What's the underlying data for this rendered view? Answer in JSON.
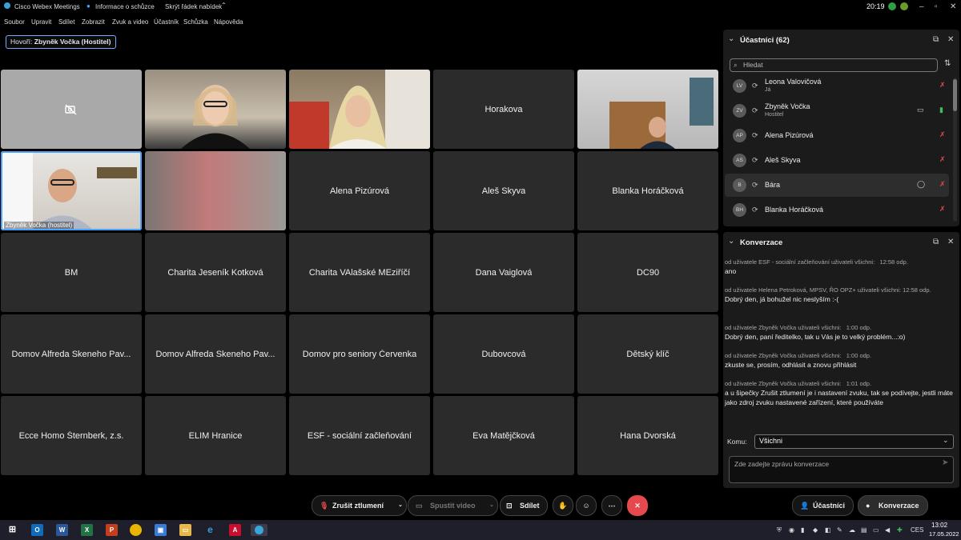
{
  "title_bar": {
    "app_name": "Cisco Webex Meetings",
    "meeting_info": "Informace o schůzce",
    "hide_menu": "Skrýt řádek nabídek",
    "time": "20:19"
  },
  "menu": [
    "Soubor",
    "Upravit",
    "Sdílet",
    "Zobrazit",
    "Zvuk a video",
    "Účastník",
    "Schůzka",
    "Nápověda"
  ],
  "speaker_label": "Hovoří: ",
  "speaker_name": "Zbyněk Vočka (Hostitel)",
  "tiles": [
    {
      "name": "",
      "type": "camera-off"
    },
    {
      "name": "",
      "type": "video"
    },
    {
      "name": "",
      "type": "video"
    },
    {
      "name": "Horakova",
      "type": "name"
    },
    {
      "name": "",
      "type": "video"
    },
    {
      "name": "Zbyněk Vočka (hostitel)",
      "type": "video-caption"
    },
    {
      "name": "",
      "type": "blurred"
    },
    {
      "name": "Alena Pizúrová",
      "type": "name"
    },
    {
      "name": "Aleš Skyva",
      "type": "name"
    },
    {
      "name": "Blanka Horáčková",
      "type": "name"
    },
    {
      "name": "BM",
      "type": "name"
    },
    {
      "name": "Charita Jeseník Kotková",
      "type": "name"
    },
    {
      "name": "Charita VAlašské MEziříčí",
      "type": "name"
    },
    {
      "name": "Dana Vaiglová",
      "type": "name"
    },
    {
      "name": "DC90",
      "type": "name"
    },
    {
      "name": "Domov Alfreda Skeneho Pav...",
      "type": "name"
    },
    {
      "name": "Domov Alfreda Skeneho Pav...",
      "type": "name"
    },
    {
      "name": "Domov pro seniory Červenka",
      "type": "name"
    },
    {
      "name": "Dubovcová",
      "type": "name"
    },
    {
      "name": "Dětský klíč",
      "type": "name"
    },
    {
      "name": "Ecce Homo Šternberk, z.s.",
      "type": "name"
    },
    {
      "name": "ELIM Hranice",
      "type": "name"
    },
    {
      "name": "ESF - sociální začleňování",
      "type": "name"
    },
    {
      "name": "Eva Matějčková",
      "type": "name"
    },
    {
      "name": "Hana Dvorská",
      "type": "name"
    }
  ],
  "participants_panel": {
    "title": "Účastníci (62)",
    "search_placeholder": "Hledat",
    "items": [
      {
        "initials": "LV",
        "name": "Leona Valovičová",
        "sub": "Já"
      },
      {
        "initials": "ZV",
        "name": "Zbyněk Vočka",
        "sub": "Hostitel"
      },
      {
        "initials": "AP",
        "name": "Alena Pizúrová",
        "sub": ""
      },
      {
        "initials": "AS",
        "name": "Aleš Skyva",
        "sub": ""
      },
      {
        "initials": "B",
        "name": "Bára",
        "sub": ""
      },
      {
        "initials": "BH",
        "name": "Blanka Horáčková",
        "sub": ""
      }
    ]
  },
  "chat_panel": {
    "title": "Konverzace",
    "messages": [
      {
        "meta": "od uživatele ESF - sociální začleňování uživateli všichni:",
        "time": "12:58 odp.",
        "text": "ano"
      },
      {
        "meta": "od uživatele Helena Petroková, MPSV, ŘO OPZ+ uživateli všichni:",
        "time": "12:58 odp.",
        "text": "Dobrý den, já bohužel nic neslyším :-("
      },
      {
        "meta": "od uživatele Zbyněk Vočka uživateli všichni:",
        "time": "1:00 odp.",
        "text": "Dobrý den, paní ředitelko, tak u Vás je to velký problém...:o)"
      },
      {
        "meta": "od uživatele Zbyněk Vočka uživateli všichni:",
        "time": "1:00 odp.",
        "text": "zkuste se, prosím, odhlásit a znovu přihlásit"
      },
      {
        "meta": "od uživatele Zbyněk Vočka uživateli všichni:",
        "time": "1:01 odp.",
        "text": "a u šipečky Zrušit ztlumení je i nastavení zvuku, tak se podívejte, jestli máte jako zdroj zvuku nastavené zařízení, které používáte"
      }
    ],
    "to_label": "Komu:",
    "to_value": "Všichni",
    "input_placeholder": "Zde zadejte zprávu konverzace"
  },
  "controls": {
    "unmute": "Zrušit ztlumení",
    "start_video": "Spustit video",
    "share": "Sdílet",
    "participants": "Účastníci",
    "chat": "Konverzace"
  },
  "taskbar": {
    "lang": "CES",
    "time": "13:02",
    "date": "17.05.2022"
  },
  "colors": {
    "accent": "#4aa3ff",
    "danger": "#e5484d",
    "panel": "#1b1b1b",
    "tile": "#2b2b2b"
  }
}
